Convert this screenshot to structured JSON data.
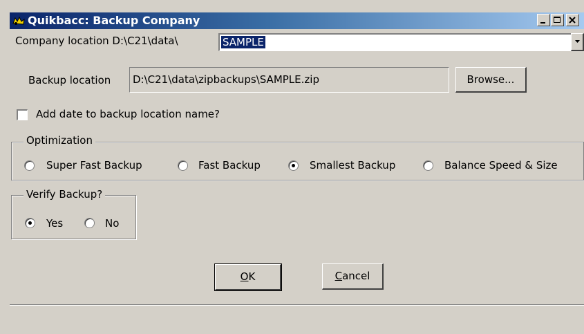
{
  "window": {
    "title": "Quikbacc: Backup Company",
    "icon": "quikbacc-app-icon",
    "controls": [
      "minimize",
      "maximize",
      "close"
    ]
  },
  "company": {
    "label": "Company location D:\\C21\\data\\",
    "value": "SAMPLE"
  },
  "backup": {
    "label": "Backup location",
    "value": "D:\\C21\\data\\zipbackups\\SAMPLE.zip",
    "browse_label": "Browse..."
  },
  "add_date": {
    "label": "Add date to backup location name?",
    "checked": false
  },
  "optimization": {
    "legend": "Optimization",
    "options": [
      {
        "label": "Super Fast Backup",
        "selected": false
      },
      {
        "label": "Fast Backup",
        "selected": false
      },
      {
        "label": "Smallest Backup",
        "selected": true
      },
      {
        "label": "Balance Speed & Size",
        "selected": false
      }
    ]
  },
  "verify": {
    "legend": "Verify Backup?",
    "options": [
      {
        "label": "Yes",
        "selected": true
      },
      {
        "label": "No",
        "selected": false
      }
    ]
  },
  "buttons": {
    "ok_mnemonic": "O",
    "ok_rest": "K",
    "cancel_mnemonic": "C",
    "cancel_rest": "ancel"
  },
  "colors": {
    "title_gradient_start": "#0a246a",
    "title_gradient_end": "#a6caf0",
    "face": "#d4d0c8",
    "selection": "#0a246a"
  }
}
